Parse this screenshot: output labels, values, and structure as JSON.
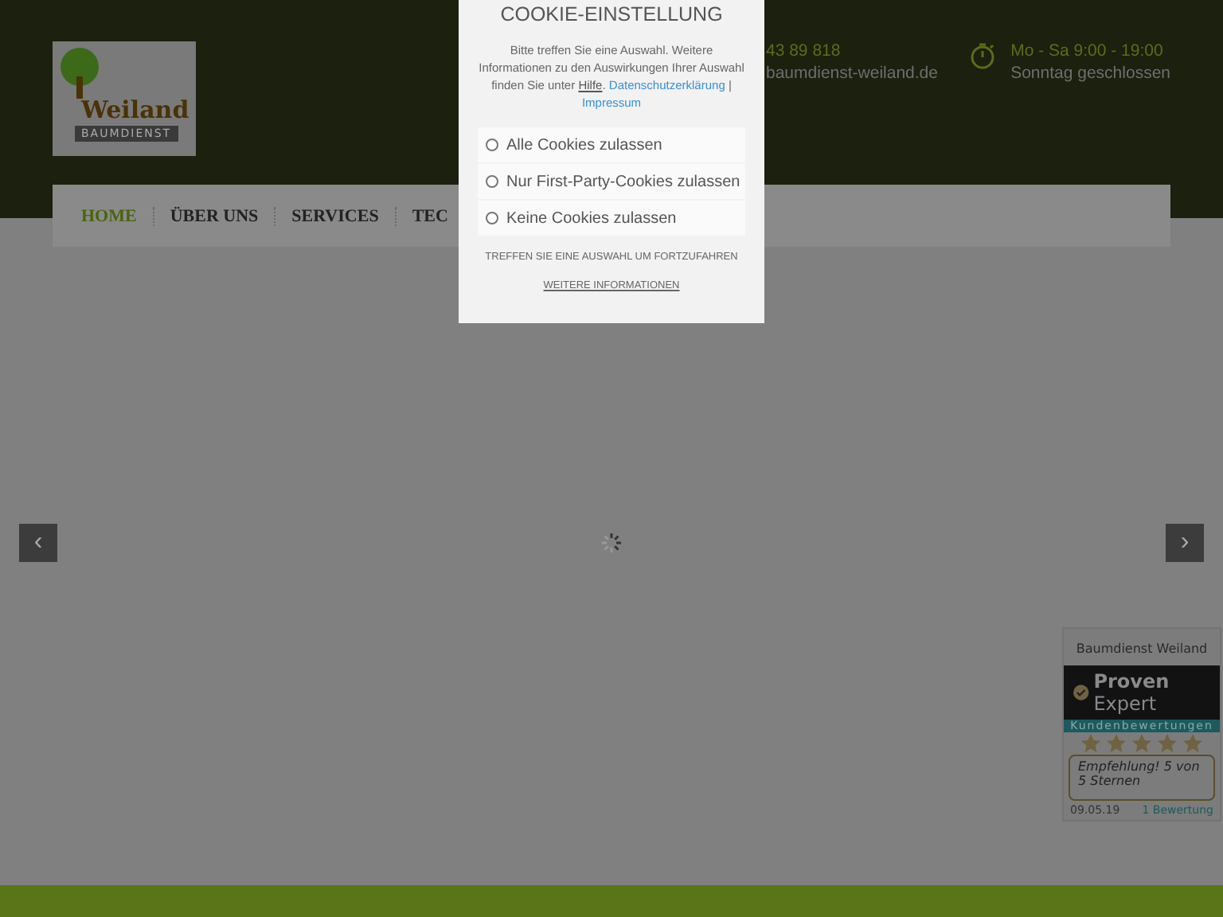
{
  "header": {
    "logo": {
      "word": "Weiland",
      "sub": "BAUMDIENST"
    },
    "phone": "43 89 818",
    "email": "baumdienst-weiland.de",
    "hours": "Mo - Sa 9:00 - 19:00",
    "closed": "Sonntag geschlossen"
  },
  "nav": [
    {
      "label": "HOME",
      "selected": true
    },
    {
      "label": "ÜBER UNS",
      "selected": false
    },
    {
      "label": "SERVICES",
      "selected": false
    },
    {
      "label": "TEC",
      "selected": false
    }
  ],
  "slider": {
    "prev": "‹",
    "next": "›"
  },
  "review_widget": {
    "company": "Baumdienst Weiland",
    "brand_bold": "Proven",
    "brand_light": "Expert",
    "banner": "Kundenbewertungen",
    "stars": 5,
    "quote": "Empfehlung! 5 von 5 Sternen",
    "date": "09.05.19",
    "count": "1 Bewertung"
  },
  "cookie_dialog": {
    "title": "COOKIE-EINSTELLUNG",
    "intro": "Bitte treffen Sie eine Auswahl. Weitere Informationen zu den Auswirkungen Ihrer Auswahl finden Sie unter",
    "help_link": "Hilfe",
    "help_suffix": ".",
    "privacy_link": "Datenschutzerklärung",
    "separator": "|",
    "imprint_link": "Impressum",
    "options": [
      {
        "label": "Alle Cookies zulassen",
        "selected": false
      },
      {
        "label": "Nur First-Party-Cookies zulassen",
        "selected": false
      },
      {
        "label": "Keine Cookies zulassen",
        "selected": false
      }
    ],
    "hint": "TREFFEN SIE EINE AUSWAHL UM FORTZUFAHREN",
    "more_link": "WEITERE INFORMATIONEN"
  }
}
